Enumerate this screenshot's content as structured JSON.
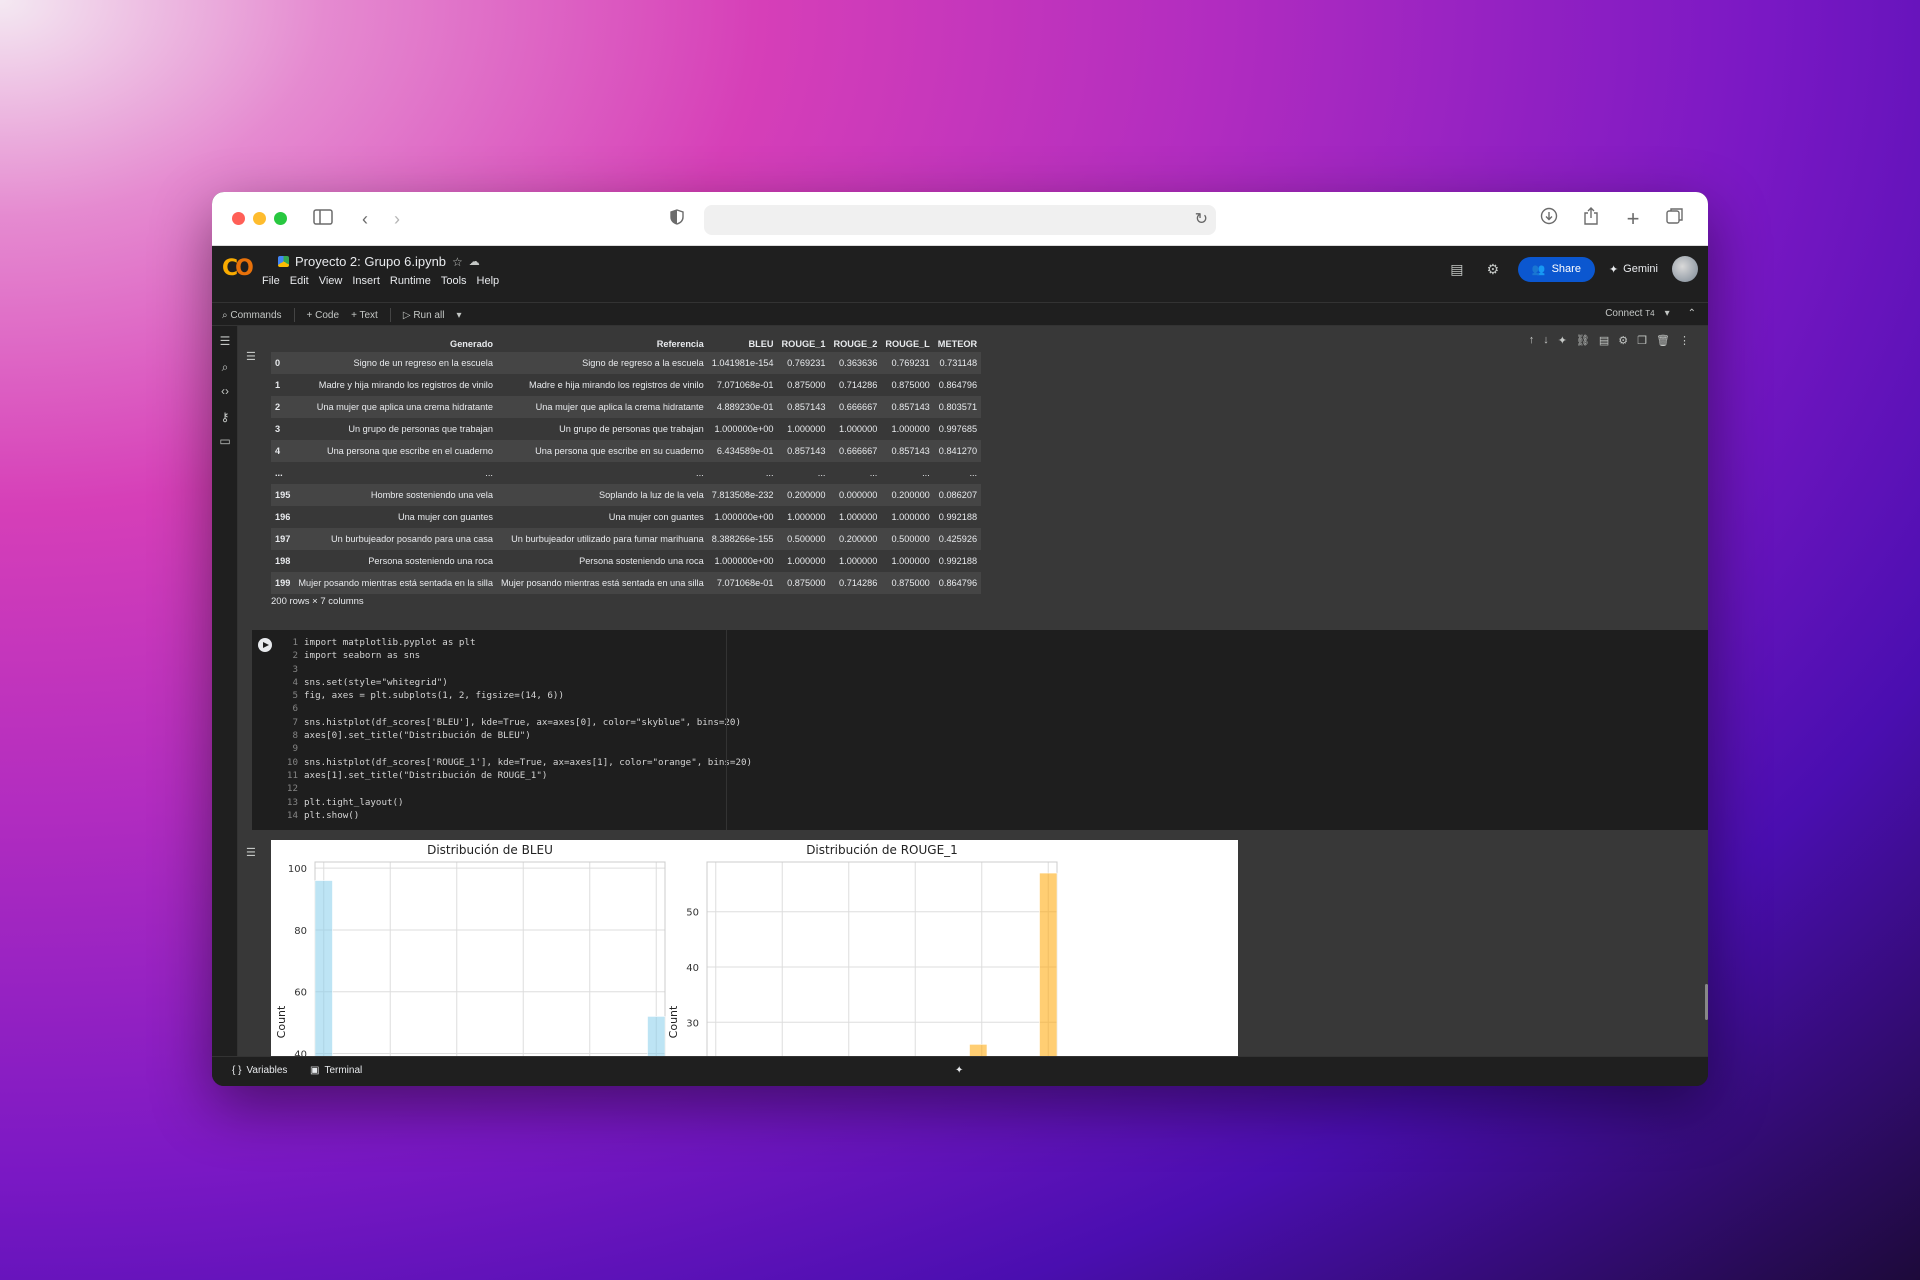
{
  "notebook": {
    "title": "Proyecto 2: Grupo 6.ipynb",
    "menus": [
      "File",
      "Edit",
      "View",
      "Insert",
      "Runtime",
      "Tools",
      "Help"
    ],
    "share_label": "Share",
    "gemini_label": "Gemini"
  },
  "cmdbar": {
    "commands": "Commands",
    "code": "+ Code",
    "text": "+ Text",
    "run_all": "Run all",
    "connect": "Connect",
    "t4": "T4"
  },
  "dataframe": {
    "columns": [
      "Generado",
      "Referencia",
      "BLEU",
      "ROUGE_1",
      "ROUGE_2",
      "ROUGE_L",
      "METEOR"
    ],
    "rows": [
      [
        "0",
        "Signo de un regreso en la escuela",
        "Signo de regreso a la escuela",
        "1.041981e-154",
        "0.769231",
        "0.363636",
        "0.769231",
        "0.731148"
      ],
      [
        "1",
        "Madre y hija mirando los registros de vinilo",
        "Madre e hija mirando los registros de vinilo",
        "7.071068e-01",
        "0.875000",
        "0.714286",
        "0.875000",
        "0.864796"
      ],
      [
        "2",
        "Una mujer que aplica una crema hidratante",
        "Una mujer que aplica la crema hidratante",
        "4.889230e-01",
        "0.857143",
        "0.666667",
        "0.857143",
        "0.803571"
      ],
      [
        "3",
        "Un grupo de personas que trabajan",
        "Un grupo de personas que trabajan",
        "1.000000e+00",
        "1.000000",
        "1.000000",
        "1.000000",
        "0.997685"
      ],
      [
        "4",
        "Una persona que escribe en el cuaderno",
        "Una persona que escribe en su cuaderno",
        "6.434589e-01",
        "0.857143",
        "0.666667",
        "0.857143",
        "0.841270"
      ],
      [
        "...",
        "...",
        "...",
        "...",
        "...",
        "...",
        "...",
        "..."
      ],
      [
        "195",
        "Hombre sosteniendo una vela",
        "Soplando la luz de la vela",
        "7.813508e-232",
        "0.200000",
        "0.000000",
        "0.200000",
        "0.086207"
      ],
      [
        "196",
        "Una mujer con guantes",
        "Una mujer con guantes",
        "1.000000e+00",
        "1.000000",
        "1.000000",
        "1.000000",
        "0.992188"
      ],
      [
        "197",
        "Un burbujeador posando para una casa",
        "Un burbujeador utilizado para fumar marihuana",
        "8.388266e-155",
        "0.500000",
        "0.200000",
        "0.500000",
        "0.425926"
      ],
      [
        "198",
        "Persona sosteniendo una roca",
        "Persona sosteniendo una roca",
        "1.000000e+00",
        "1.000000",
        "1.000000",
        "1.000000",
        "0.992188"
      ],
      [
        "199",
        "Mujer posando mientras está sentada en la silla",
        "Mujer posando mientras está sentada en una silla",
        "7.071068e-01",
        "0.875000",
        "0.714286",
        "0.875000",
        "0.864796"
      ]
    ],
    "shape_label": "200 rows × 7 columns"
  },
  "code_lines": [
    "import matplotlib.pyplot as plt",
    "import seaborn as sns",
    "",
    "sns.set(style=\"whitegrid\")",
    "fig, axes = plt.subplots(1, 2, figsize=(14, 6))",
    "",
    "sns.histplot(df_scores['BLEU'], kde=True, ax=axes[0], color=\"skyblue\", bins=20)",
    "axes[0].set_title(\"Distribución de BLEU\")",
    "",
    "sns.histplot(df_scores['ROUGE_1'], kde=True, ax=axes[1], color=\"orange\", bins=20)",
    "axes[1].set_title(\"Distribución de ROUGE_1\")",
    "",
    "plt.tight_layout()",
    "plt.show()"
  ],
  "chart_data": [
    {
      "type": "bar",
      "title": "Distribución de BLEU",
      "xlabel": "",
      "ylabel": "Count",
      "yticks": [
        40,
        60,
        80,
        100
      ],
      "ylim_visible": [
        34,
        102
      ],
      "xlim": [
        0,
        1
      ],
      "color": "#87ceeb",
      "bars": [
        {
          "x0": 0.0,
          "x1": 0.05,
          "count": 96
        },
        {
          "x0": 0.95,
          "x1": 1.0,
          "count": 52
        }
      ],
      "grid": true
    },
    {
      "type": "bar",
      "title": "Distribución de ROUGE_1",
      "xlabel": "",
      "ylabel": "Count",
      "yticks": [
        30,
        40,
        50
      ],
      "ylim_visible": [
        21,
        59
      ],
      "xlim": [
        0,
        1
      ],
      "color": "#ffa500",
      "bars": [
        {
          "x0": 0.75,
          "x1": 0.8,
          "count": 26
        },
        {
          "x0": 0.95,
          "x1": 1.0,
          "count": 57
        }
      ],
      "grid": true
    }
  ],
  "status": {
    "variables": "Variables",
    "terminal": "Terminal"
  },
  "icons": {
    "run": "play-icon",
    "star": "star-icon",
    "cloud": "cloud-icon"
  }
}
